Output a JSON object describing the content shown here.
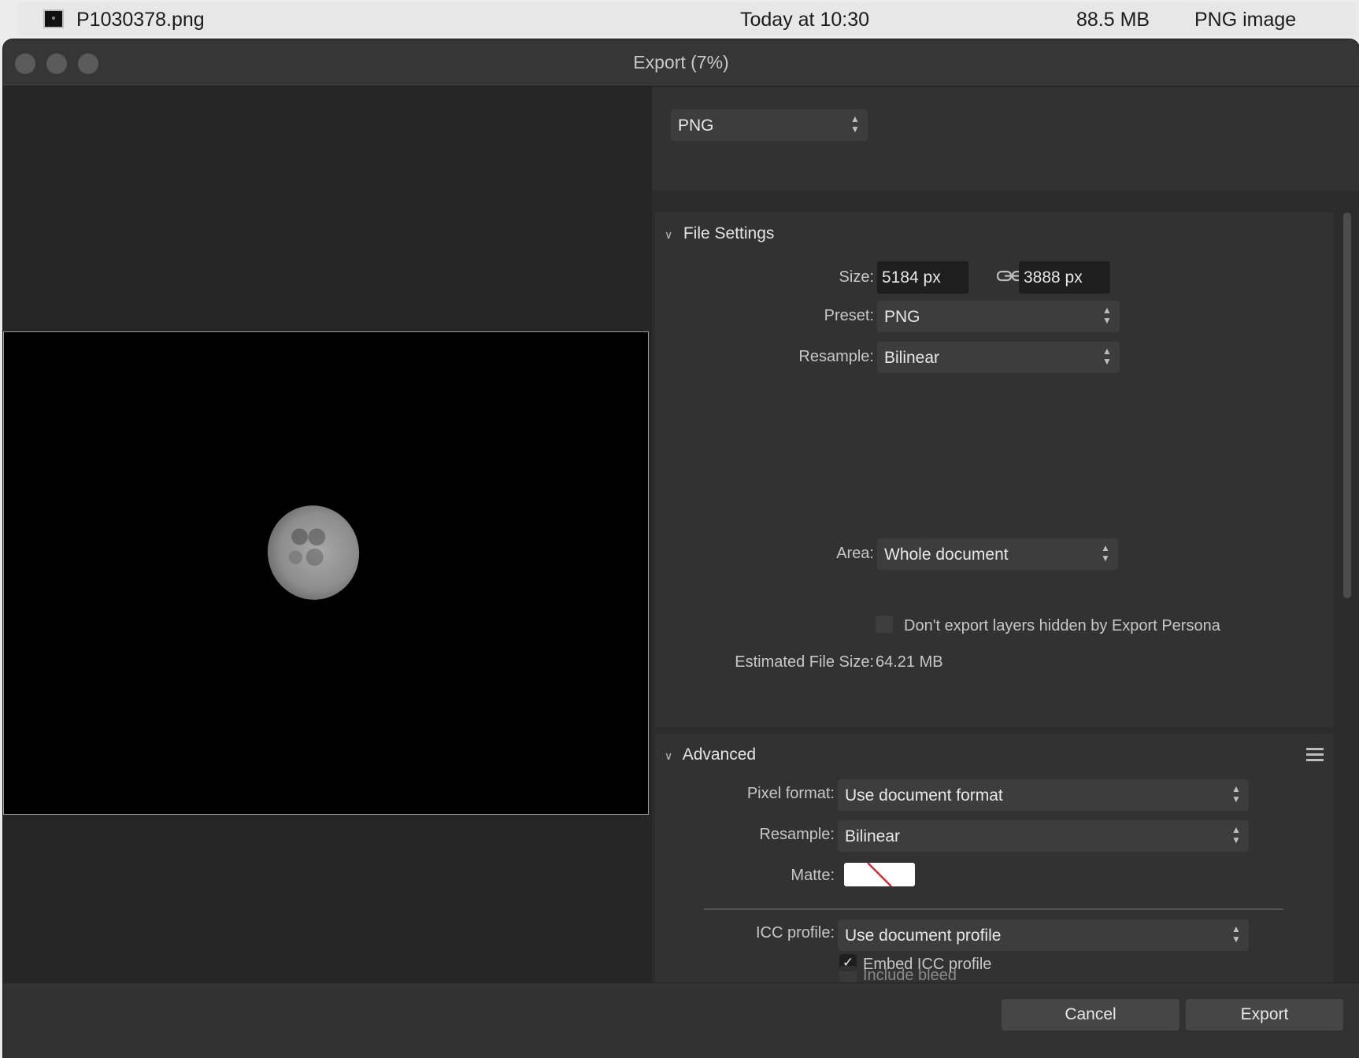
{
  "finder": {
    "file_name": "P1030378.png",
    "date": "Today at 10:30",
    "size": "88.5 MB",
    "kind": "PNG image"
  },
  "window": {
    "title": "Export (7%)"
  },
  "format": {
    "selected": "PNG"
  },
  "file_settings": {
    "header": "File Settings",
    "size_label": "Size:",
    "width": "5184 px",
    "height": "3888 px",
    "preset_label": "Preset:",
    "preset": "PNG",
    "resample_label": "Resample:",
    "resample": "Bilinear",
    "area_label": "Area:",
    "area": "Whole document",
    "hidden_layers_label": "Don't export layers hidden by Export Persona",
    "hidden_layers_checked": false,
    "est_size_label": "Estimated File Size:",
    "est_size": "64.21 MB"
  },
  "advanced": {
    "header": "Advanced",
    "pixel_format_label": "Pixel format:",
    "pixel_format": "Use document format",
    "resample_label": "Resample:",
    "resample": "Bilinear",
    "matte_label": "Matte:",
    "icc_label": "ICC profile:",
    "icc": "Use document profile",
    "embed_icc_label": "Embed ICC profile",
    "embed_icc_checked": true,
    "include_bleed_label": "Include bleed",
    "include_bleed_checked": false
  },
  "buttons": {
    "cancel": "Cancel",
    "export": "Export"
  },
  "colors": {
    "window_bg": "#323232",
    "preview_bg": "#262626",
    "field_bg": "#1e1e1e",
    "select_bg": "#3d3d3d"
  }
}
